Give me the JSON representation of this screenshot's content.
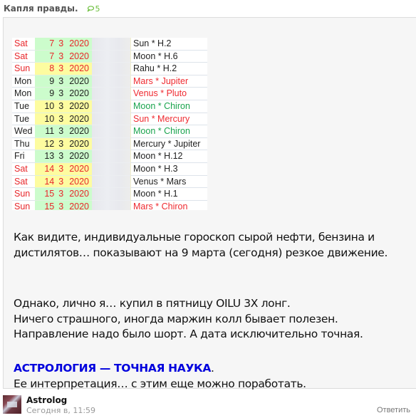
{
  "post": {
    "title": "Капля правды.",
    "comment_count": "5",
    "comment_icon": "speech-bubble-icon"
  },
  "table": {
    "rows": [
      {
        "day": "Sat",
        "d": "7",
        "m": "3",
        "y": "2020",
        "aspect": "Sun * H.2",
        "day_color": "red",
        "date_bg": "green",
        "aspect_color": "dark"
      },
      {
        "day": "Sat",
        "d": "7",
        "m": "3",
        "y": "2020",
        "aspect": "Moon * H.6",
        "day_color": "red",
        "date_bg": "green",
        "aspect_color": "dark"
      },
      {
        "day": "Sun",
        "d": "8",
        "m": "3",
        "y": "2020",
        "aspect": "Rahu * H.2",
        "day_color": "red",
        "date_bg": "yellow",
        "aspect_color": "dark"
      },
      {
        "day": "Mon",
        "d": "9",
        "m": "3",
        "y": "2020",
        "aspect": "Mars * Jupiter",
        "day_color": "dark",
        "date_bg": "green",
        "aspect_color": "red"
      },
      {
        "day": "Mon",
        "d": "9",
        "m": "3",
        "y": "2020",
        "aspect": "Venus * Pluto",
        "day_color": "dark",
        "date_bg": "green",
        "aspect_color": "red"
      },
      {
        "day": "Tue",
        "d": "10",
        "m": "3",
        "y": "2020",
        "aspect": "Moon * Chiron",
        "day_color": "dark",
        "date_bg": "yellow",
        "aspect_color": "green"
      },
      {
        "day": "Tue",
        "d": "10",
        "m": "3",
        "y": "2020",
        "aspect": "Sun * Mercury",
        "day_color": "dark",
        "date_bg": "yellow",
        "aspect_color": "red"
      },
      {
        "day": "Wed",
        "d": "11",
        "m": "3",
        "y": "2020",
        "aspect": "Moon * Chiron",
        "day_color": "dark",
        "date_bg": "green",
        "aspect_color": "green"
      },
      {
        "day": "Thu",
        "d": "12",
        "m": "3",
        "y": "2020",
        "aspect": "Mercury * Jupiter",
        "day_color": "dark",
        "date_bg": "yellow",
        "aspect_color": "dark"
      },
      {
        "day": "Fri",
        "d": "13",
        "m": "3",
        "y": "2020",
        "aspect": "Moon * H.12",
        "day_color": "dark",
        "date_bg": "green",
        "aspect_color": "dark"
      },
      {
        "day": "Sat",
        "d": "14",
        "m": "3",
        "y": "2020",
        "aspect": "Moon * H.3",
        "day_color": "red",
        "date_bg": "yellow",
        "aspect_color": "dark"
      },
      {
        "day": "Sat",
        "d": "14",
        "m": "3",
        "y": "2020",
        "aspect": "Venus * Mars",
        "day_color": "red",
        "date_bg": "yellow",
        "aspect_color": "dark"
      },
      {
        "day": "Sun",
        "d": "15",
        "m": "3",
        "y": "2020",
        "aspect": "Moon * H.1",
        "day_color": "red",
        "date_bg": "green",
        "aspect_color": "dark"
      },
      {
        "day": "Sun",
        "d": "15",
        "m": "3",
        "y": "2020",
        "aspect": "Mars * Chiron",
        "day_color": "red",
        "date_bg": "green",
        "aspect_color": "red"
      }
    ]
  },
  "body": {
    "p1_line1": "Как видите, индивидуальные гороскоп сырой нефти, бензина и",
    "p1_line2": "дистилятов… показывают на 9 марта (сегодня) резкое движение.",
    "p2_line1": "Однако, лично я… купил в пятницу OILU 3X лонг.",
    "p2_line2": "Ничего страшного, иногда маржин колл бывает полезен.",
    "p2_line3": "Направление надо было шорт. А дата исключительно точная.",
    "p3_accent": "АСТРОЛОГИЯ — ТОЧНАЯ НАУКА",
    "p3_accent_tail": ".",
    "p3_line2": "Ее интерпретация… с этим еще можно поработать."
  },
  "author": {
    "name": "Astrolog",
    "time": "Сегодня в, 11:59",
    "reply_label": "Ответить"
  },
  "colors": {
    "comments_green": "#6cbf3c",
    "accent_blue": "#0000dd",
    "red": "#e8262a",
    "green_text": "#1aa44e",
    "date_green_bg": "#ccfccc",
    "date_yellow_bg": "#fdfca0"
  }
}
